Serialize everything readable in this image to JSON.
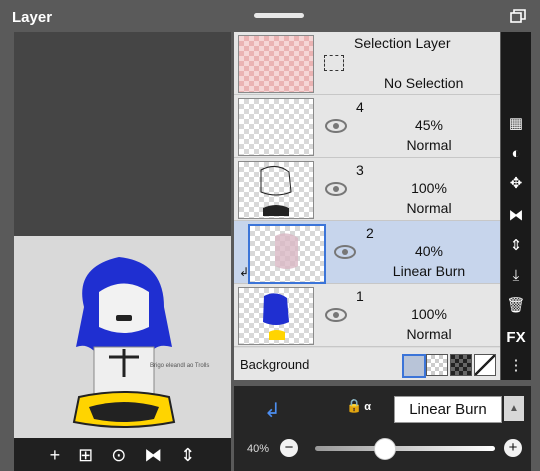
{
  "header": {
    "title": "Layer"
  },
  "canvas": {
    "toolbar": [
      "+",
      "⊞",
      "⊙",
      "⧓",
      "⇕"
    ],
    "watermark": "Brigo eleandl ao Trolls"
  },
  "layers": [
    {
      "id": "selection",
      "title": "Selection Layer",
      "subtitle": "No Selection"
    },
    {
      "id": "4",
      "number": "4",
      "opacity": "45%",
      "mode": "Normal"
    },
    {
      "id": "3",
      "number": "3",
      "opacity": "100%",
      "mode": "Normal"
    },
    {
      "id": "2",
      "number": "2",
      "opacity": "40%",
      "mode": "Linear Burn",
      "selected": true
    },
    {
      "id": "1",
      "number": "1",
      "opacity": "100%",
      "mode": "Normal"
    }
  ],
  "background": {
    "label": "Background"
  },
  "sidebar": {
    "fx_label": "FX"
  },
  "bottom": {
    "blend_mode": "Linear Burn",
    "alpha_label": "α",
    "opacity_label": "40%",
    "opacity_value": 0.4
  },
  "colors": {
    "selected_row": "#c7d5ec",
    "accent": "#3b74d8"
  }
}
